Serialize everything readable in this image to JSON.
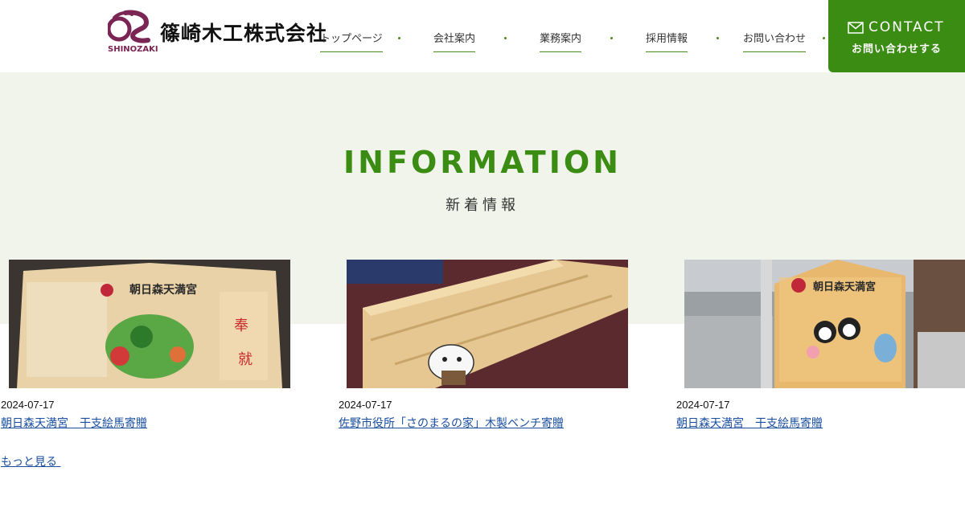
{
  "header": {
    "logo_sub": "SHINOZAKI",
    "company": "篠崎木工株式会社",
    "nav": [
      {
        "label": "トップページ"
      },
      {
        "label": "会社案内"
      },
      {
        "label": "業務案内"
      },
      {
        "label": "採用情報"
      },
      {
        "label": "お問い合わせ"
      }
    ],
    "contact": {
      "en": "CONTACT",
      "ja": "お問い合わせする",
      "icon": "mail-icon"
    }
  },
  "info": {
    "title": "INFORMATION",
    "subtitle": "新着情報",
    "posts": [
      {
        "date": "2024-07-17",
        "title": "朝日森天満宮　干支絵馬寄贈",
        "image_text": "朝日森天満宮"
      },
      {
        "date": "2024-07-17",
        "title": "佐野市役所「さのまるの家」木製ベンチ寄贈",
        "image_text": ""
      },
      {
        "date": "2024-07-17",
        "title": "朝日森天満宮　干支絵馬寄贈",
        "image_text": "朝日森天満宮"
      }
    ],
    "more": "もっと見る "
  },
  "colors": {
    "brand_green": "#3a8c12",
    "logo_maroon": "#7a2553",
    "section_bg": "#f1f4ea",
    "link": "#1a4fa0"
  }
}
